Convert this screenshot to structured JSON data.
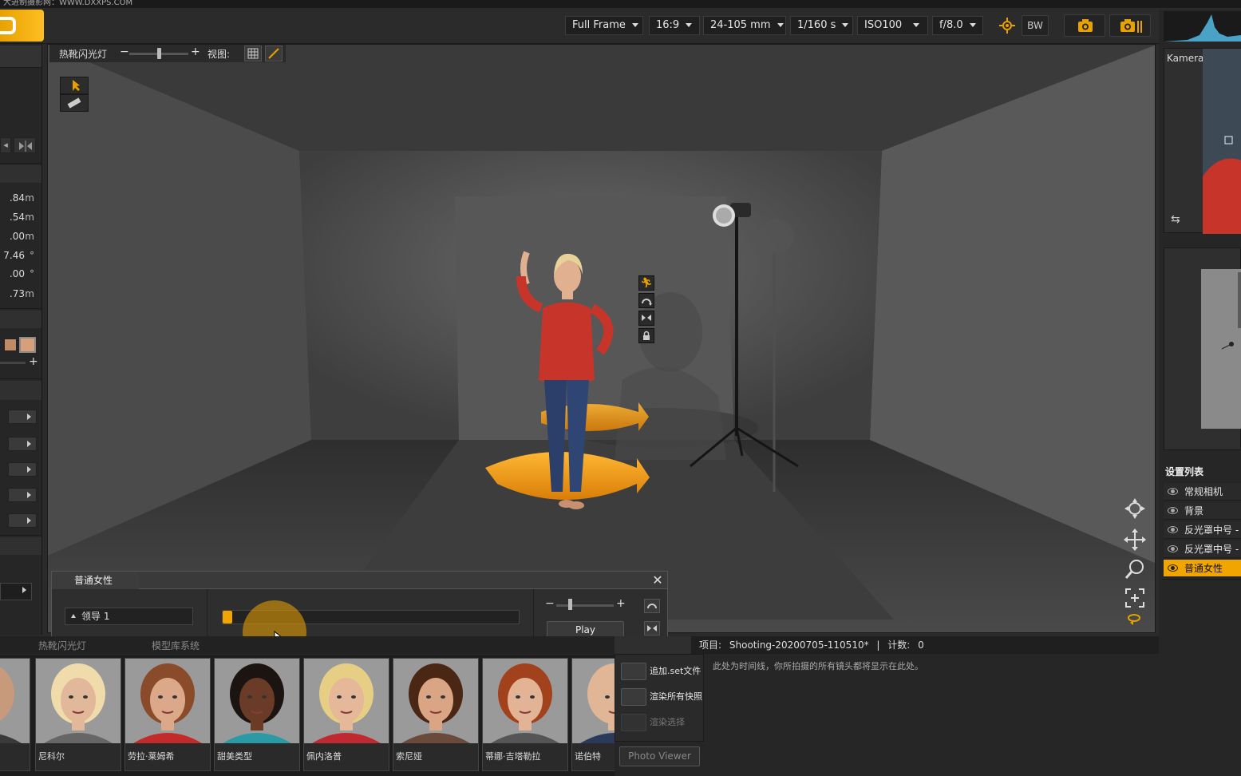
{
  "title_strip": "大进制摄影网：WWW.DXXPS.COM",
  "camera_bar": {
    "sensor": "Full Frame",
    "aspect": "16:9",
    "lens": "24-105 mm",
    "shutter": "1/160 s",
    "iso": "ISO100",
    "aperture": "f/8.0",
    "bw": "BW"
  },
  "viewport_toolbar": {
    "label": "热靴闪光灯",
    "view_label": "视图:"
  },
  "left_panel": {
    "values": [
      {
        "value": ".84",
        "unit": "m"
      },
      {
        "value": ".54",
        "unit": "m"
      },
      {
        "value": ".00",
        "unit": "m"
      },
      {
        "value": "7.46",
        "unit": "°"
      },
      {
        "value": ".00",
        "unit": "°"
      },
      {
        "value": ".73",
        "unit": "m"
      }
    ]
  },
  "right_panel": {
    "kamera_label": "Kamera",
    "settings_header": "设置列表",
    "items": [
      "常规相机",
      "背景",
      "反光罩中号 -",
      "反光罩中号 -",
      "普通女性"
    ],
    "selected_index": 4
  },
  "anim_panel": {
    "tab": "普通女性",
    "dropdown": "领导 1",
    "play": "Play"
  },
  "bottom_tabs": [
    "热靴闪光灯",
    "模型库系统"
  ],
  "models": [
    {
      "name": "",
      "skin": "#c89a7c",
      "hair": "#c89a7c",
      "shirt": "#3a3a3a"
    },
    {
      "name": "尼科尔",
      "skin": "#e2b89a",
      "hair": "#efdcaa",
      "shirt": "#666"
    },
    {
      "name": "劳拉·莱姆希",
      "skin": "#dba98a",
      "hair": "#8a4b2a",
      "shirt": "#c32a2a"
    },
    {
      "name": "甜美类型",
      "skin": "#6a3c28",
      "hair": "#1b1410",
      "shirt": "#2a9aa5"
    },
    {
      "name": "佩内洛普",
      "skin": "#e4b899",
      "hair": "#e6cf85",
      "shirt": "#c0292f"
    },
    {
      "name": "索尼娅",
      "skin": "#d9a584",
      "hair": "#4a2615",
      "shirt": "#6a4a3a"
    },
    {
      "name": "蒂娜·吉塔勒拉",
      "skin": "#e2b394",
      "hair": "#a2421d",
      "shirt": "#555"
    },
    {
      "name": "诺伯特",
      "skin": "#e0b696",
      "hair": "#e0b696",
      "shirt": "#2b3a5a"
    }
  ],
  "timeline": {
    "project_label": "项目:",
    "project": "Shooting-20200705-110510*",
    "count_label": "计数:",
    "count": "0",
    "hint": "此处为时间线，你所拍摄的所有镜头都将显示在此处。",
    "buttons": [
      "追加.set文件",
      "渲染所有快照",
      "渲染选择"
    ],
    "photo_viewer": "Photo Viewer"
  },
  "colors": {
    "accent": "#f0a500",
    "panel": "#262626",
    "viewport": "#3a3a3a"
  }
}
